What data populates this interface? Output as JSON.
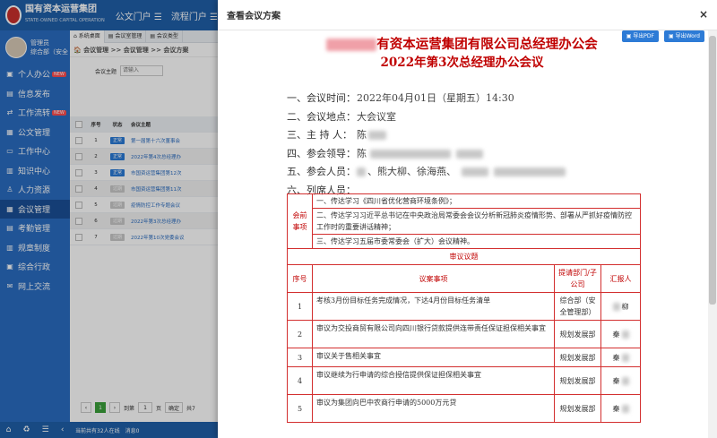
{
  "header": {
    "brand_name": "国有资本运营集团",
    "brand_sub": "STATE-OWNED CAPITAL OPERATION",
    "nav": [
      "公文门户 ☰",
      "流程门户 ☰"
    ]
  },
  "sidebar": {
    "user_name": "管理员",
    "user_dept": "综合部（安全",
    "items": [
      {
        "label": "个人办公",
        "icon": "person-icon",
        "badge": "NEW"
      },
      {
        "label": "信息发布",
        "icon": "document-icon",
        "badge": ""
      },
      {
        "label": "工作流转",
        "icon": "flow-icon",
        "badge": "NEW"
      },
      {
        "label": "公文管理",
        "icon": "folder-icon",
        "badge": ""
      },
      {
        "label": "工作中心",
        "icon": "monitor-icon",
        "badge": ""
      },
      {
        "label": "知识中心",
        "icon": "book-icon",
        "badge": ""
      },
      {
        "label": "人力资源",
        "icon": "user-icon",
        "badge": ""
      },
      {
        "label": "会议管理",
        "icon": "meeting-icon",
        "badge": "",
        "active": true
      },
      {
        "label": "考勤管理",
        "icon": "calendar-icon",
        "badge": ""
      },
      {
        "label": "规章制度",
        "icon": "rules-icon",
        "badge": ""
      },
      {
        "label": "综合行政",
        "icon": "admin-icon",
        "badge": ""
      },
      {
        "label": "网上交流",
        "icon": "chat-icon",
        "badge": ""
      }
    ],
    "bottom_icons": [
      "⌂",
      "♻",
      "☰",
      "‹"
    ]
  },
  "main": {
    "tabs": [
      "系统桌面",
      "会议室管理",
      "会议类型"
    ],
    "breadcrumb": "会议管理 >> 会议管理 >> 会议方案",
    "search_label": "会议主题",
    "search_placeholder": "请输入",
    "table_headers": [
      "序号",
      "状态",
      "会议主题"
    ],
    "rows": [
      {
        "no": "1",
        "status": "正常",
        "status_color": "#2a7ad6",
        "title": "第一届第十六次董事会"
      },
      {
        "no": "2",
        "status": "正常",
        "status_color": "#2a7ad6",
        "title": "2022年第4次总经理办"
      },
      {
        "no": "3",
        "status": "正常",
        "status_color": "#2a7ad6",
        "title": "市国资运营集团第12次"
      },
      {
        "no": "4",
        "status": "过期",
        "status_color": "#c8c8c8",
        "title": "市国资运营集团第11次"
      },
      {
        "no": "5",
        "status": "过期",
        "status_color": "#c8c8c8",
        "title": "疫情防控工作专题会议"
      },
      {
        "no": "6",
        "status": "过期",
        "status_color": "#c8c8c8",
        "title": "2022年第3次总经理办"
      },
      {
        "no": "7",
        "status": "过期",
        "status_color": "#c8c8c8",
        "title": "2022年第10次党委会议"
      }
    ],
    "pager": {
      "prev": "‹",
      "current": "1",
      "next": "›",
      "goto_label": "到第",
      "goto_value": "1",
      "page_unit": "页",
      "confirm": "确定",
      "total": "共7"
    },
    "status_online": "当前共有32人在线",
    "status_msg": "消息0"
  },
  "dialog": {
    "title": "查看会议方案",
    "close": "×",
    "export_pdf": "导出PDF",
    "export_word": "导出Word",
    "doc_title_1": "有资本运营集团有限公司总经理办公会",
    "doc_title_2": "2022年第3次总经理办公会议",
    "info": [
      {
        "label": "一、会议时间：",
        "value": "2022年04月01日（星期五）14:30"
      },
      {
        "label": "二、会议地点：",
        "value": "大会议室"
      },
      {
        "label": "三、主 持 人：",
        "value": "陈"
      },
      {
        "label": "四、参会领导：",
        "value": "陈"
      },
      {
        "label": "五、参会人员：",
        "value": "、熊大柳、徐海燕、"
      },
      {
        "label": "六、列席人员：",
        "value": ""
      }
    ],
    "items_label": "会前\n事项",
    "pre_items": [
      "一、传达学习《四川省优化营商环境条例》；",
      "二、传达学习习近平总书记在中央政治局常委会会议分析新冠肺炎疫情形势、部署从严抓好疫情防控工作时的重要讲话精神；",
      "三、传达学习五届市委常委会（扩大）会议精神。"
    ],
    "agenda_heading": "审议议题",
    "agenda_headers": [
      "序号",
      "议案事项",
      "提请部门/子公司",
      "汇报人"
    ],
    "agenda_rows": [
      {
        "no": "1",
        "item": "考核3月份目标任务完成情况，下达4月份目标任务清单",
        "dept": "综合部（安全管理部）",
        "reporter": "柳"
      },
      {
        "no": "2",
        "item": "审议为交投商贸有限公司向四川银行贷款提供连带责任保证担保相关事宜",
        "dept": "规划发展部",
        "reporter": "秦"
      },
      {
        "no": "3",
        "item": "审议关于售相关事宜",
        "dept": "规划发展部",
        "reporter": "秦"
      },
      {
        "no": "4",
        "item": "审议继续为行申请的综合授信提供保证担保相关事宜",
        "dept": "规划发展部",
        "reporter": "秦"
      },
      {
        "no": "5",
        "item": "审议为集团向巴中农商行申请的5000万元贷",
        "dept": "规划发展部",
        "reporter": "秦"
      }
    ]
  }
}
